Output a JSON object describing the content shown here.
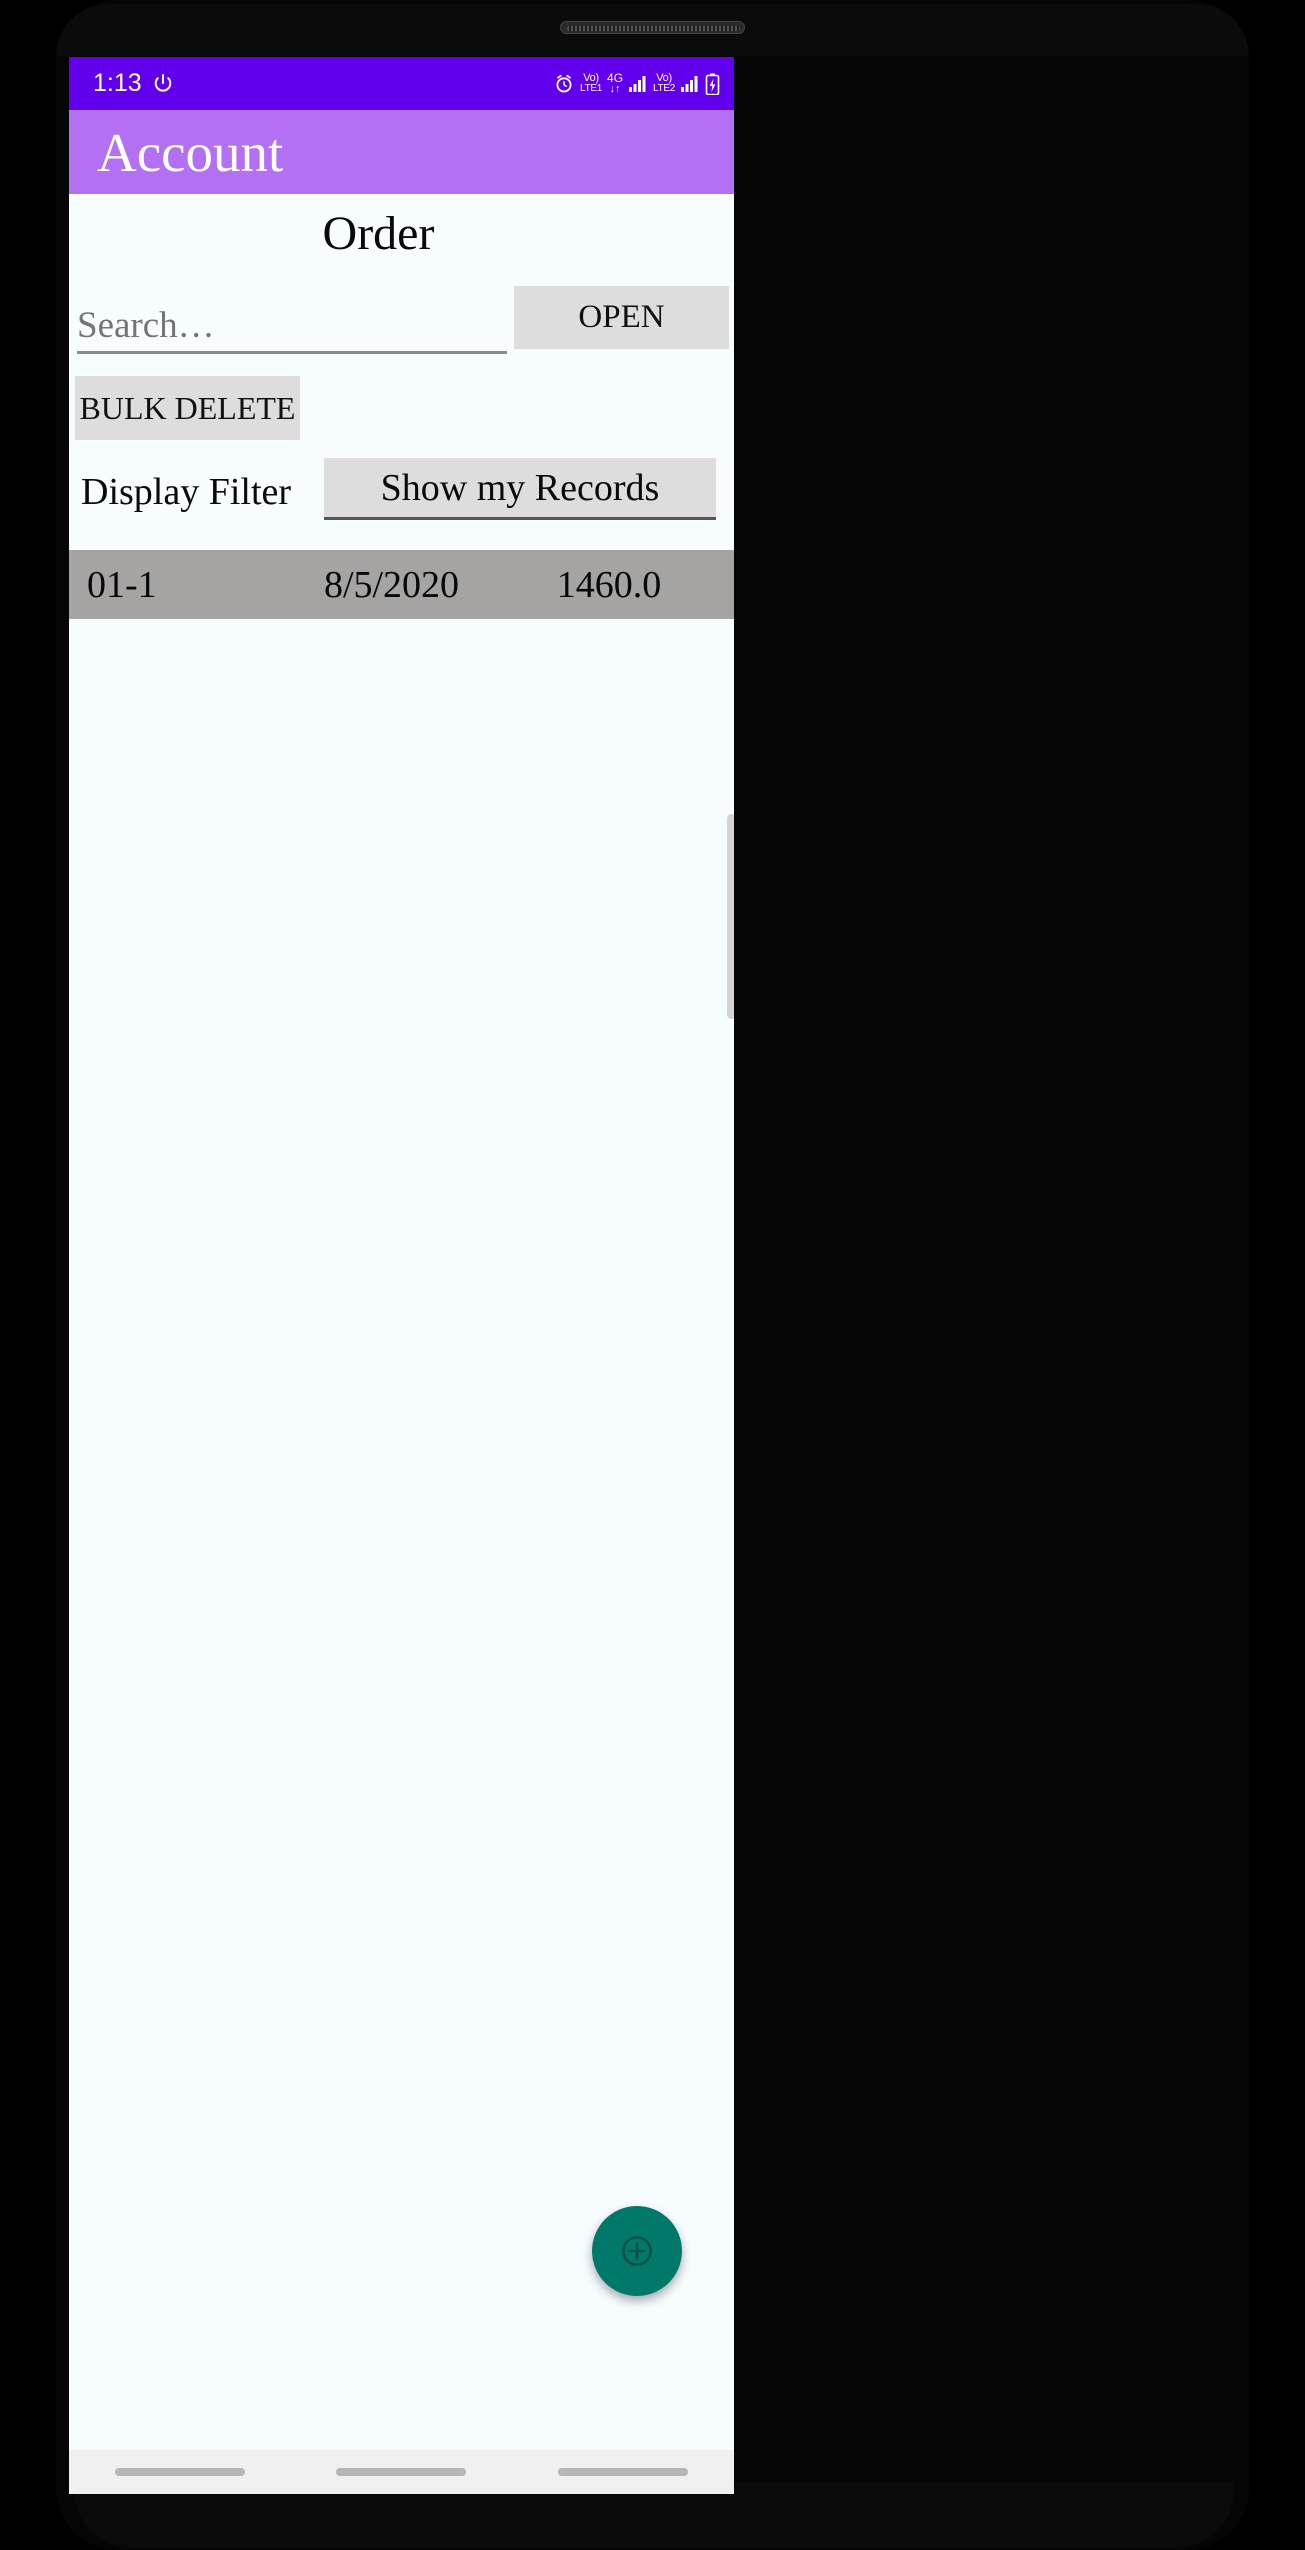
{
  "status_bar": {
    "time": "1:13",
    "power_icon": "power-icon",
    "alarm_icon": "alarm-clock-icon",
    "sim1": {
      "top": "Vo)",
      "bottom": "LTE1"
    },
    "data_type": {
      "top": "4G",
      "bottom": "↓↑"
    },
    "signal1_icon": "signal-bars-icon",
    "sim2": {
      "top": "Vo)",
      "bottom": "LTE2"
    },
    "signal2_icon": "signal-bars-icon",
    "battery_icon": "battery-charging-icon",
    "background": "#6200ee",
    "foreground": "#ffffff"
  },
  "app_bar": {
    "title": "Account",
    "background": "#b370f5",
    "text_color": "#ffffff"
  },
  "page": {
    "title": "Order",
    "background": "#f7fcff"
  },
  "search": {
    "value": "",
    "placeholder": "Search…"
  },
  "buttons": {
    "open_label": "OPEN",
    "bulk_delete_label": "BULK DELETE",
    "button_background": "#dddddd"
  },
  "display_filter": {
    "label": "Display Filter",
    "selected": "Show my Records",
    "options": [
      "Show my Records"
    ]
  },
  "table": {
    "row_background": "#a6a3a3",
    "rows": [
      {
        "id": "01-1",
        "date": "8/5/2020",
        "amount": "1460.0"
      }
    ]
  },
  "fab": {
    "icon": "add-circle-icon",
    "color": "#00796b"
  },
  "nav_bar": {
    "items": [
      "recents-pill",
      "home-pill",
      "back-pill"
    ],
    "background": "#f0f0f0"
  }
}
